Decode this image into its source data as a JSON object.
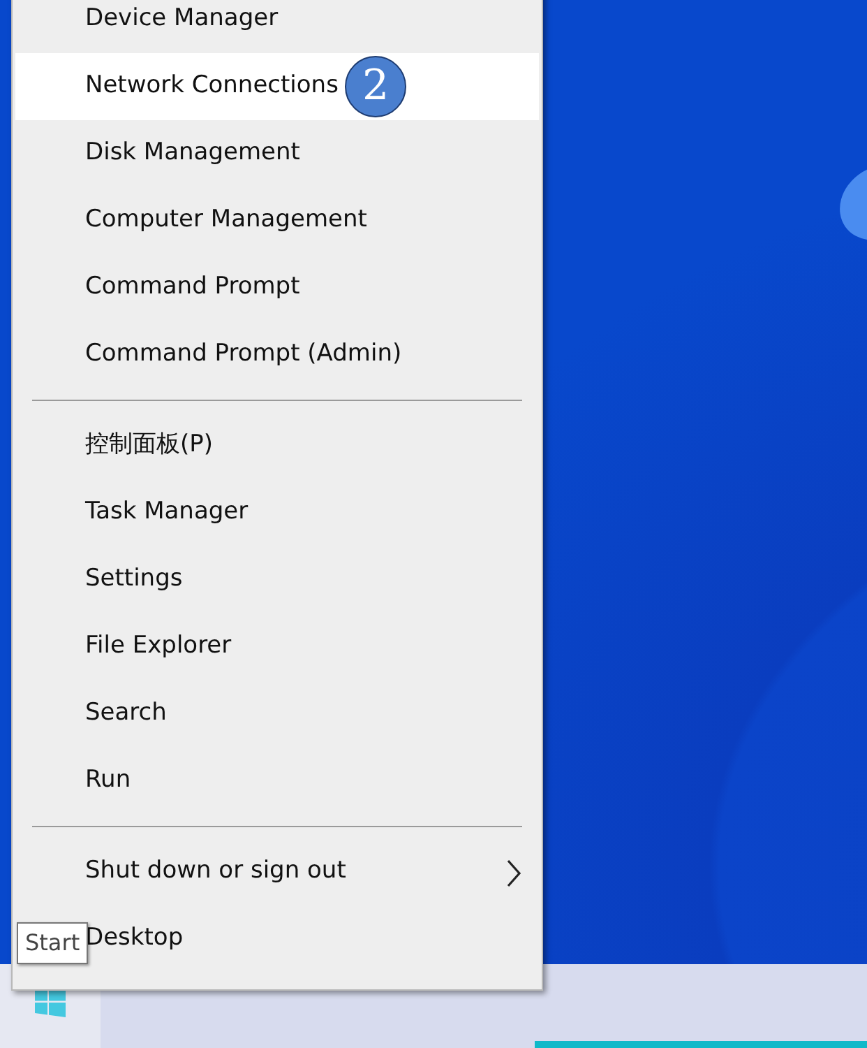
{
  "menu": {
    "groups": [
      [
        {
          "label": "Device Manager",
          "selected": false,
          "kind": "item"
        },
        {
          "label": "Network Connections",
          "selected": true,
          "kind": "item",
          "annotation": "2"
        },
        {
          "label": "Disk Management",
          "selected": false,
          "kind": "item"
        },
        {
          "label": "Computer Management",
          "selected": false,
          "kind": "item"
        },
        {
          "label": "Command Prompt",
          "selected": false,
          "kind": "item"
        },
        {
          "label": "Command Prompt (Admin)",
          "selected": false,
          "kind": "item"
        }
      ],
      [
        {
          "label": "控制面板(P)",
          "selected": false,
          "kind": "item"
        },
        {
          "label": "Task Manager",
          "selected": false,
          "kind": "item"
        },
        {
          "label": "Settings",
          "selected": false,
          "kind": "item"
        },
        {
          "label": "File Explorer",
          "selected": false,
          "kind": "item"
        },
        {
          "label": "Search",
          "selected": false,
          "kind": "item"
        },
        {
          "label": "Run",
          "selected": false,
          "kind": "item"
        }
      ],
      [
        {
          "label": "Shut down or sign out",
          "selected": false,
          "kind": "submenu"
        },
        {
          "label": "Desktop",
          "selected": false,
          "kind": "item"
        }
      ]
    ]
  },
  "tooltip": {
    "text": "Start"
  }
}
